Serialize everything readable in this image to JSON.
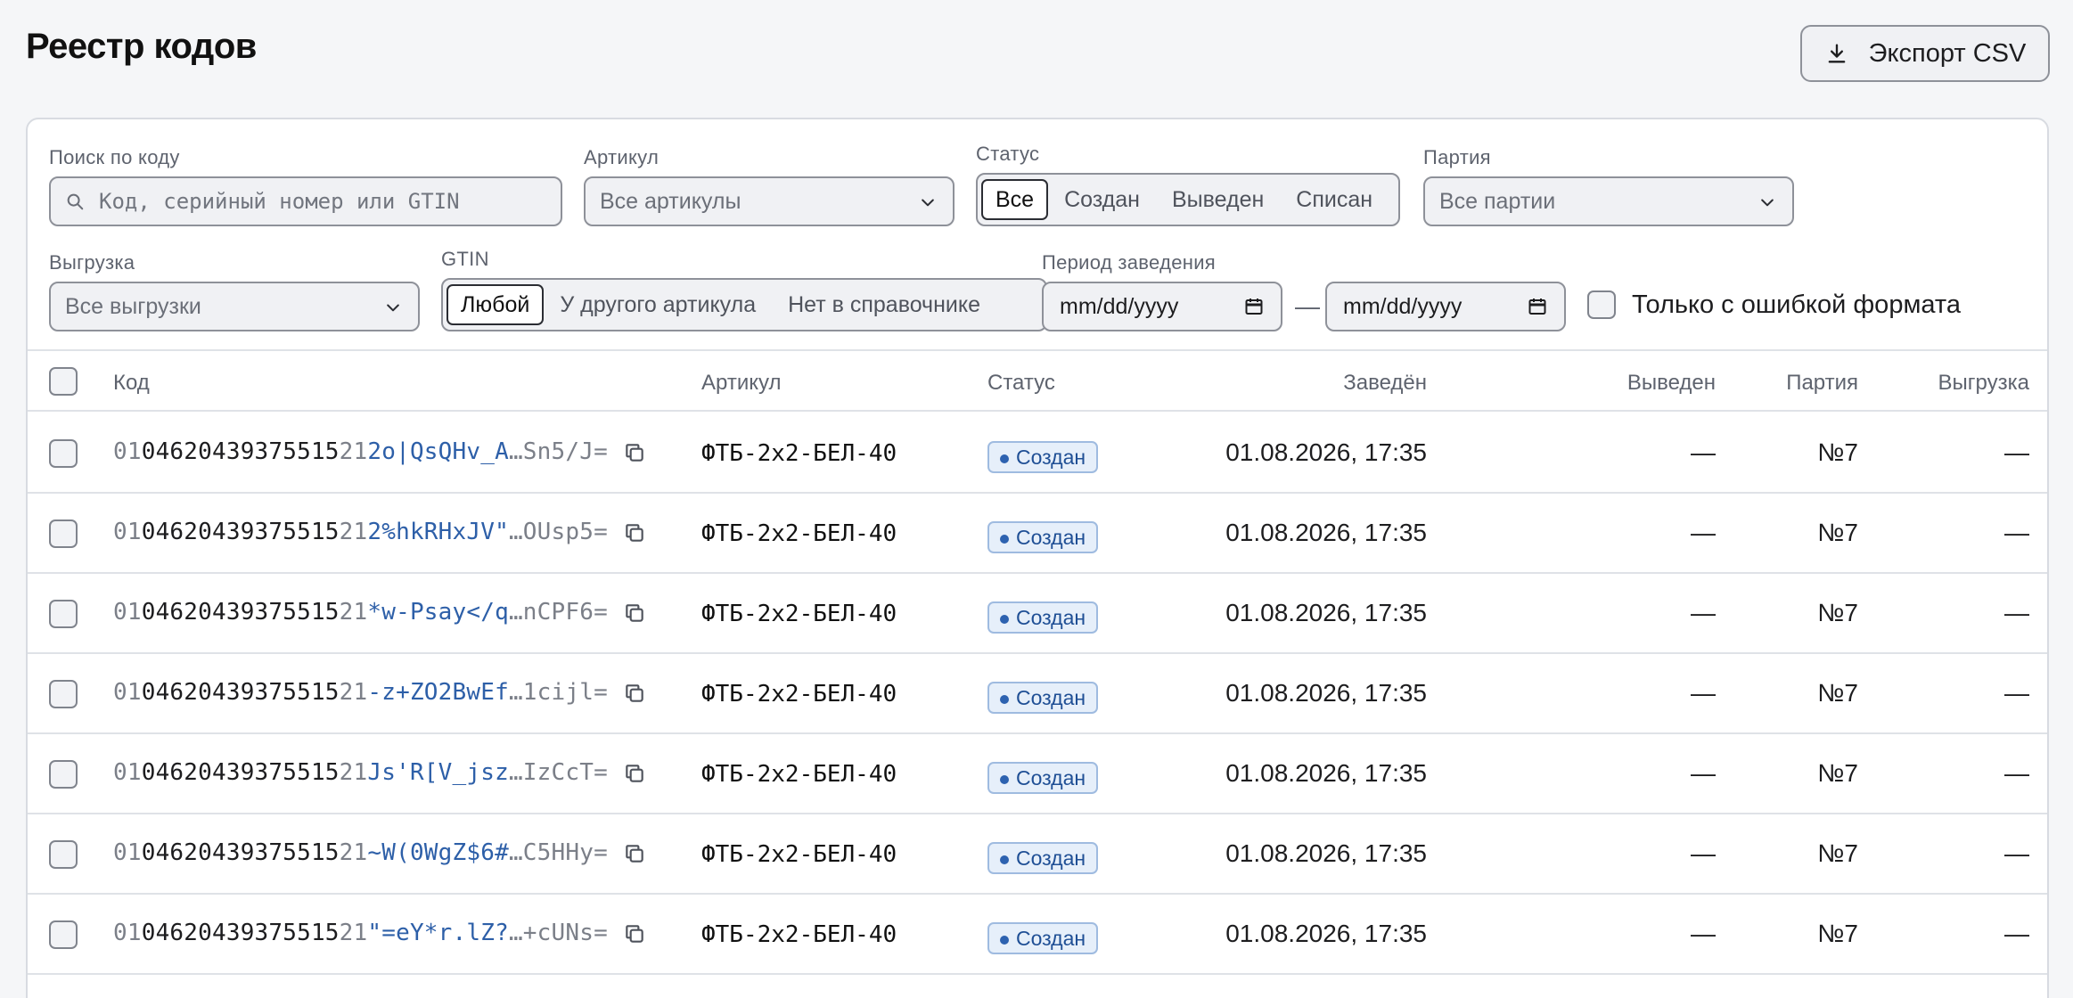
{
  "header": {
    "title": "Реестр кодов",
    "export_label": "Экспорт CSV"
  },
  "filters": {
    "search": {
      "label": "Поиск по коду",
      "placeholder": "Код, серийный номер или GTIN"
    },
    "sku": {
      "label": "Артикул",
      "value": "Все артикулы"
    },
    "status": {
      "label": "Статус",
      "options": [
        "Все",
        "Создан",
        "Выведен",
        "Списан"
      ],
      "selected": "Все"
    },
    "batch": {
      "label": "Партия",
      "value": "Все партии"
    },
    "upload": {
      "label": "Выгрузка",
      "value": "Все выгрузки"
    },
    "gtin": {
      "label": "GTIN",
      "options": [
        "Любой",
        "У другого артикула",
        "Нет в справочнике"
      ],
      "selected": "Любой"
    },
    "period": {
      "label": "Период заведения",
      "from": "mm/dd/yyyy",
      "to": "mm/dd/yyyy",
      "separator": "—"
    },
    "format_error": {
      "label": "Только с ошибкой формата",
      "checked": false
    }
  },
  "table": {
    "columns": {
      "code": "Код",
      "sku": "Артикул",
      "status": "Статус",
      "created": "Заведён",
      "withdrawn": "Выведен",
      "batch": "Партия",
      "upload": "Выгрузка"
    },
    "rows": [
      {
        "ai": "01",
        "gtin": "04620439375515",
        "serial_prefix": "21",
        "serial": "2o|QsQHv_A",
        "ellipsis": "…",
        "tail": "Sn5/J=",
        "sku": "ФТБ-2х2-БЕЛ-40",
        "status": "Создан",
        "created": "01.08.2026, 17:35",
        "withdrawn": "—",
        "batch": "№7",
        "upload": "—"
      },
      {
        "ai": "01",
        "gtin": "04620439375515",
        "serial_prefix": "21",
        "serial": "2%hkRHxJV\"",
        "ellipsis": "…",
        "tail": "OUsp5=",
        "sku": "ФТБ-2х2-БЕЛ-40",
        "status": "Создан",
        "created": "01.08.2026, 17:35",
        "withdrawn": "—",
        "batch": "№7",
        "upload": "—"
      },
      {
        "ai": "01",
        "gtin": "04620439375515",
        "serial_prefix": "21",
        "serial": "*w-Psay</q",
        "ellipsis": "…",
        "tail": "nCPF6=",
        "sku": "ФТБ-2х2-БЕЛ-40",
        "status": "Создан",
        "created": "01.08.2026, 17:35",
        "withdrawn": "—",
        "batch": "№7",
        "upload": "—"
      },
      {
        "ai": "01",
        "gtin": "04620439375515",
        "serial_prefix": "21",
        "serial": "-z+ZO2BwEf",
        "ellipsis": "…",
        "tail": "1cijl=",
        "sku": "ФТБ-2х2-БЕЛ-40",
        "status": "Создан",
        "created": "01.08.2026, 17:35",
        "withdrawn": "—",
        "batch": "№7",
        "upload": "—"
      },
      {
        "ai": "01",
        "gtin": "04620439375515",
        "serial_prefix": "21",
        "serial": "Js'R[V_jsz",
        "ellipsis": "…",
        "tail": "IzCcT=",
        "sku": "ФТБ-2х2-БЕЛ-40",
        "status": "Создан",
        "created": "01.08.2026, 17:35",
        "withdrawn": "—",
        "batch": "№7",
        "upload": "—"
      },
      {
        "ai": "01",
        "gtin": "04620439375515",
        "serial_prefix": "21",
        "serial": "~W(0WgZ$6#",
        "ellipsis": "…",
        "tail": "C5HHy=",
        "sku": "ФТБ-2х2-БЕЛ-40",
        "status": "Создан",
        "created": "01.08.2026, 17:35",
        "withdrawn": "—",
        "batch": "№7",
        "upload": "—"
      },
      {
        "ai": "01",
        "gtin": "04620439375515",
        "serial_prefix": "21",
        "serial": "\"=eY*r.lZ?",
        "ellipsis": "…",
        "tail": "+cUNs=",
        "sku": "ФТБ-2х2-БЕЛ-40",
        "status": "Создан",
        "created": "01.08.2026, 17:35",
        "withdrawn": "—",
        "batch": "№7",
        "upload": "—"
      }
    ]
  },
  "icons": {
    "export": "download-icon",
    "search": "search-icon",
    "dropdown": "chevron-down-icon",
    "calendar": "calendar-icon",
    "copy": "copy-icon"
  },
  "colors": {
    "serial": "#2d5fa8",
    "badge_bg": "#e6effa",
    "badge_border": "#9fbbe0",
    "badge_text": "#1f4f95"
  }
}
